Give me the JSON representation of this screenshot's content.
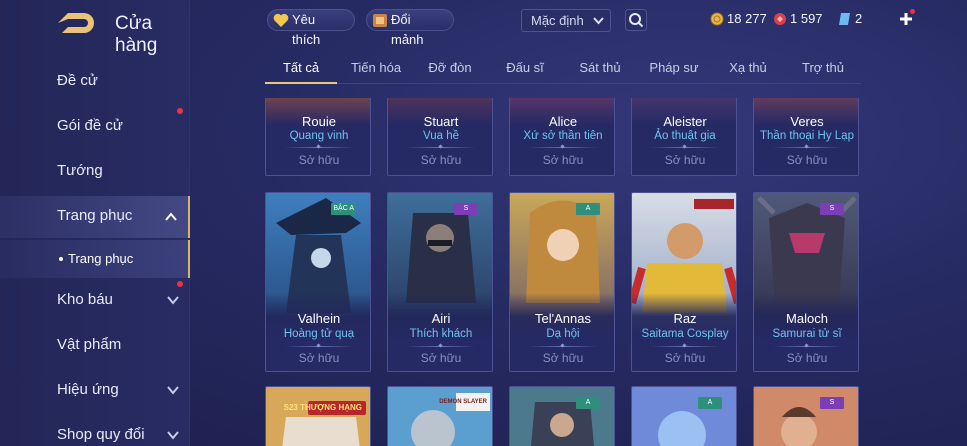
{
  "header": {
    "title": "Cửa hàng",
    "favorites_label": "Yêu thích",
    "exchange_label": "Đổi mảnh",
    "sort_value": "Mặc định",
    "currencies": [
      {
        "icon": "gold-coin-icon",
        "value": "18 277",
        "color": "#e7b74b"
      },
      {
        "icon": "red-gem-icon",
        "value": "1 597",
        "color": "#e0434a"
      },
      {
        "icon": "voucher-icon",
        "value": "2",
        "color": "#6fb8f2"
      }
    ]
  },
  "sidebar": {
    "items": [
      {
        "label": "Đề cử",
        "has_dot": false,
        "has_chevron": false
      },
      {
        "label": "Gói đề cử",
        "has_dot": true,
        "has_chevron": false
      },
      {
        "label": "Tướng",
        "has_dot": false,
        "has_chevron": false
      },
      {
        "label": "Trang phục",
        "has_dot": false,
        "has_chevron": true,
        "expanded": true
      },
      {
        "label": "Kho báu",
        "has_dot": true,
        "has_chevron": true
      },
      {
        "label": "Vật phẩm",
        "has_dot": false,
        "has_chevron": false
      },
      {
        "label": "Hiệu ứng",
        "has_dot": false,
        "has_chevron": true
      },
      {
        "label": "Shop quy đổi",
        "has_dot": false,
        "has_chevron": true
      }
    ],
    "sub_item": "Trang phục"
  },
  "tabs": [
    "Tất cả",
    "Tiến hóa",
    "Đỡ đòn",
    "Đấu sĩ",
    "Sát thủ",
    "Pháp sư",
    "Xạ thủ",
    "Trợ thủ"
  ],
  "active_tab": "Tất cả",
  "owned_label": "Sở hữu",
  "cards_row1": [
    {
      "hero": "Rouie",
      "skin": "Quang vinh"
    },
    {
      "hero": "Stuart",
      "skin": "Vua hề"
    },
    {
      "hero": "Alice",
      "skin": "Xứ sở thần tiên"
    },
    {
      "hero": "Aleister",
      "skin": "Ảo thuật gia"
    },
    {
      "hero": "Veres",
      "skin": "Thần thoại Hy Lạp"
    }
  ],
  "cards_row2": [
    {
      "hero": "Valhein",
      "skin": "Hoàng tử quạ",
      "badge": "BẬC A"
    },
    {
      "hero": "Airi",
      "skin": "Thích khách",
      "badge": "S"
    },
    {
      "hero": "Tel'Annas",
      "skin": "Dạ hội",
      "badge": "A"
    },
    {
      "hero": "Raz",
      "skin": "Saitama Cosplay",
      "badge": ""
    },
    {
      "hero": "Maloch",
      "skin": "Samurai tử sĩ",
      "badge": "S"
    }
  ],
  "cards_row3_badges": [
    "S23 THƯỢNG HẠNG",
    "DEMON SLAYER",
    "A",
    "A",
    "S"
  ]
}
